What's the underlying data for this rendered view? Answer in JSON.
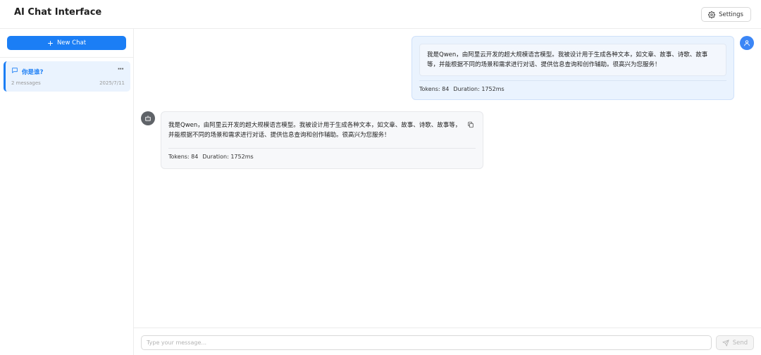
{
  "header": {
    "title": "AI Chat Interface",
    "settings_label": "Settings",
    "settings_icon": "gear-icon"
  },
  "sidebar": {
    "new_chat_label": "New Chat",
    "conversations": [
      {
        "title": "你是谁?",
        "count": "2 messages",
        "date": "2025/7/11",
        "active": true
      }
    ]
  },
  "messages": [
    {
      "role": "user",
      "text": "我是Qwen，由阿里云开发的超大规模语言模型。我被设计用于生成各种文本，如文章、故事、诗歌、故事等，并能根据不同的场景和需求进行对话、提供信息查询和创作辅助。很高兴为您服务！",
      "tokens": "Tokens: 84",
      "duration": "Duration: 1752ms"
    },
    {
      "role": "assistant",
      "text": "我是Qwen，由阿里云开发的超大规模语言模型。我被设计用于生成各种文本，如文章、故事、诗歌、故事等，并能根据不同的场景和需求进行对话、提供信息查询和创作辅助。很高兴为您服务！",
      "tokens": "Tokens: 84",
      "duration": "Duration: 1752ms"
    }
  ],
  "input": {
    "placeholder": "Type your message...",
    "value": "",
    "send_label": "Send"
  },
  "colors": {
    "accent": "#1b7ef5",
    "user_bubble": "#eaf3fe",
    "bot_bubble": "#f7f8fa",
    "bot_avatar": "#5f6368",
    "user_avatar": "#3b86f6"
  }
}
